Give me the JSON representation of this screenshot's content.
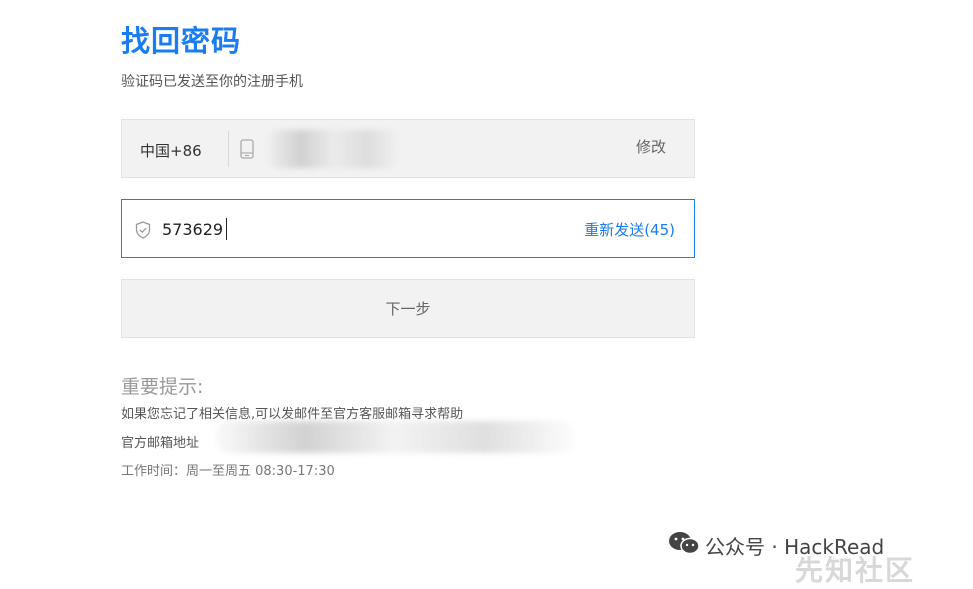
{
  "page": {
    "title": "找回密码",
    "subtitle": "验证码已发送至你的注册手机"
  },
  "phone_field": {
    "country_code": "中国+86",
    "modify_label": "修改",
    "icon": "phone-icon"
  },
  "code_field": {
    "value": "573629",
    "resend_label": "重新发送(45)",
    "icon": "shield-icon"
  },
  "next_button": {
    "label": "下一步"
  },
  "tips": {
    "title": "重要提示:",
    "line1": "如果您忘记了相关信息,可以发邮件至官方客服邮箱寻求帮助",
    "line2": "官方邮箱地址",
    "line3": "工作时间：周一至周五 08:30-17:30"
  },
  "watermark": {
    "text": "公众号 · HackRead",
    "community": "先知社区",
    "icon": "wechat-icon"
  },
  "colors": {
    "accent": "#1a7cf2",
    "field_bg": "#f2f2f2"
  }
}
